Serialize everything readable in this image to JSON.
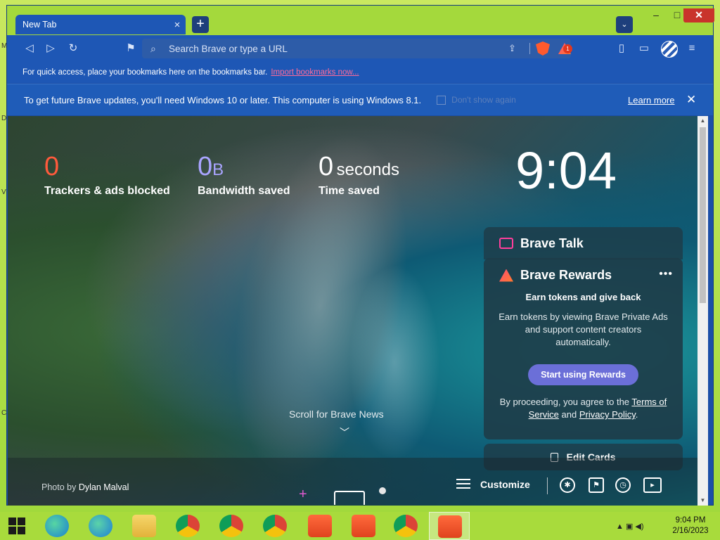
{
  "window": {
    "tab_title": "New Tab",
    "tab_close": "×",
    "new_tab": "+",
    "tab_search": "⌄",
    "minimize": "–",
    "maximize": "□",
    "close": "✕"
  },
  "toolbar": {
    "url_placeholder": "Search Brave or type a URL",
    "rewards_badge": "1"
  },
  "bookmarks_bar": {
    "hint": "For quick access, place your bookmarks here on the bookmarks bar.",
    "import_link": "Import bookmarks now..."
  },
  "infobar": {
    "message": "To get future Brave updates, you'll need Windows 10 or later. This computer is using Windows 8.1.",
    "dont_show": "Don't show again",
    "learn_more": "Learn more",
    "close": "✕"
  },
  "stats": {
    "trackers": {
      "value": "0",
      "label": "Trackers & ads blocked"
    },
    "bandwidth": {
      "value": "0",
      "unit": "B",
      "label": "Bandwidth saved"
    },
    "time": {
      "value": "0",
      "unit": "seconds",
      "label": "Time saved"
    }
  },
  "clock": "9:04",
  "brave_talk": {
    "title": "Brave Talk"
  },
  "brave_rewards": {
    "title": "Brave Rewards",
    "menu": "•••",
    "subtitle": "Earn tokens and give back",
    "body": "Earn tokens by viewing Brave Private Ads and support content creators automatically.",
    "button": "Start using Rewards",
    "legal_prefix": "By proceeding, you agree to the ",
    "terms": "Terms of Service",
    "legal_and": " and ",
    "privacy": "Privacy Policy",
    "legal_suffix": "."
  },
  "edit_cards": "Edit Cards",
  "scroll_news": "Scroll for Brave News",
  "photo_credit": {
    "prefix": "Photo by ",
    "author": "Dylan Malval"
  },
  "customize": "Customize",
  "taskbar": {
    "time": "9:04 PM",
    "date": "2/16/2023"
  },
  "colors": {
    "tracker_accent": "#ff5a3c",
    "bandwidth_accent": "#a9a4ff",
    "rewards_button": "#6b6fd8",
    "talk_icon": "#ff3f9c",
    "toolbar": "#1e57b5"
  }
}
